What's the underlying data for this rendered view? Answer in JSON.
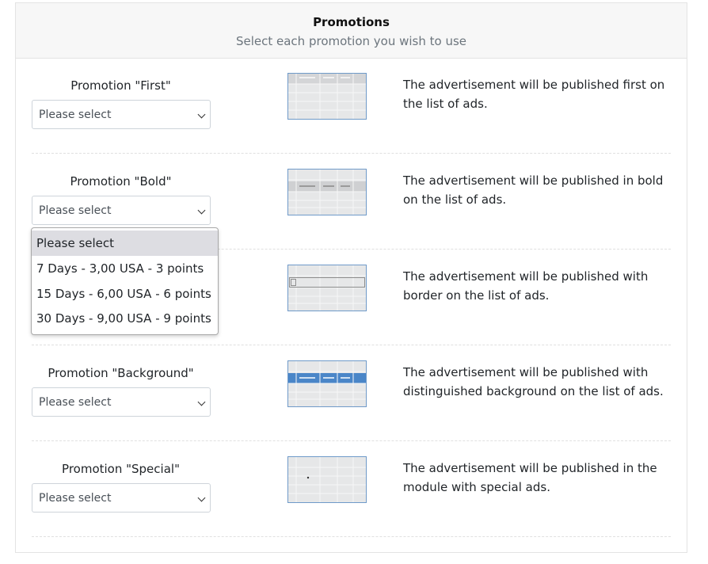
{
  "header": {
    "title": "Promotions",
    "subtitle": "Select each promotion you wish to use"
  },
  "promotions": [
    {
      "label": "Promotion \"First\"",
      "selected": "Please select",
      "description": "The advertisement will be published first on the list of ads."
    },
    {
      "label": "Promotion \"Bold\"",
      "selected": "Please select",
      "description": "The advertisement will be published in bold on the list of ads."
    },
    {
      "label": "",
      "selected": "",
      "description": "The advertisement will be published with border on the list of ads."
    },
    {
      "label": "Promotion \"Background\"",
      "selected": "Please select",
      "description": "The advertisement will be published with distinguished background on the list of ads."
    },
    {
      "label": "Promotion \"Special\"",
      "selected": "Please select",
      "description": "The advertisement will be published in the module with special ads."
    }
  ],
  "dropdown": {
    "options": [
      "Please select",
      "7 Days - 3,00 USA - 3 points",
      "15 Days - 6,00 USA - 6 points",
      "30 Days - 9,00 USA - 9 points"
    ],
    "highlighted_index": 0
  },
  "colors": {
    "thumb_border": "#6f9ac9",
    "thumb_highlight": "#4a86c8",
    "header_bg": "#f7f7f7"
  }
}
